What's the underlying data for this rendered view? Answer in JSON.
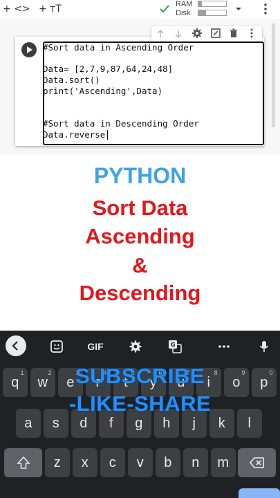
{
  "toolbar": {
    "add_code_label": "+ <>",
    "add_text_label": "+ тT",
    "ram_label": "RAM",
    "disk_label": "Disk",
    "ram_usage": 0.12,
    "disk_usage": 0.28
  },
  "cell": {
    "lines": [
      "#Sort data in Ascending Order",
      "",
      "Data= [2,7,9,87,64,24,48]",
      "Data.sort()",
      "print('Ascending',Data)",
      "",
      "",
      "#Sort data in Descending Order",
      "Data.reverse"
    ]
  },
  "overlay": {
    "line1": "PYTHON",
    "line2": "Sort Data",
    "line3": "Ascending",
    "line4": "&",
    "line5": "Descending",
    "subscribe1": "SUBSCRIBE",
    "subscribe2": "-LIKE-SHARE",
    "colors": {
      "python": "#3ea2e6",
      "sort": "#e3161b",
      "subscribe": "#1e90ff"
    }
  },
  "keyboard": {
    "suggestions": {
      "gif": "GIF"
    },
    "row1": [
      "q",
      "w",
      "e",
      "r",
      "t",
      "y",
      "u",
      "i",
      "o",
      "p"
    ],
    "row1_hints": [
      "1",
      "2",
      "3",
      "4",
      "5",
      "6",
      "7",
      "8",
      "9",
      "0"
    ],
    "row2": [
      "a",
      "s",
      "d",
      "f",
      "g",
      "h",
      "j",
      "k",
      "l"
    ],
    "row3": [
      "z",
      "x",
      "c",
      "v",
      "b",
      "n",
      "m"
    ]
  },
  "icons": [
    "back-arrow-icon",
    "sticker-icon",
    "gear-icon",
    "translate-icon",
    "more-icon",
    "microphone-icon",
    "shift-icon",
    "backspace-icon",
    "play-icon",
    "checkmark-icon",
    "dropdown-icon",
    "more-vertical-icon",
    "arrow-up-icon",
    "arrow-down-icon",
    "link-icon",
    "mirror-icon",
    "delete-icon"
  ]
}
